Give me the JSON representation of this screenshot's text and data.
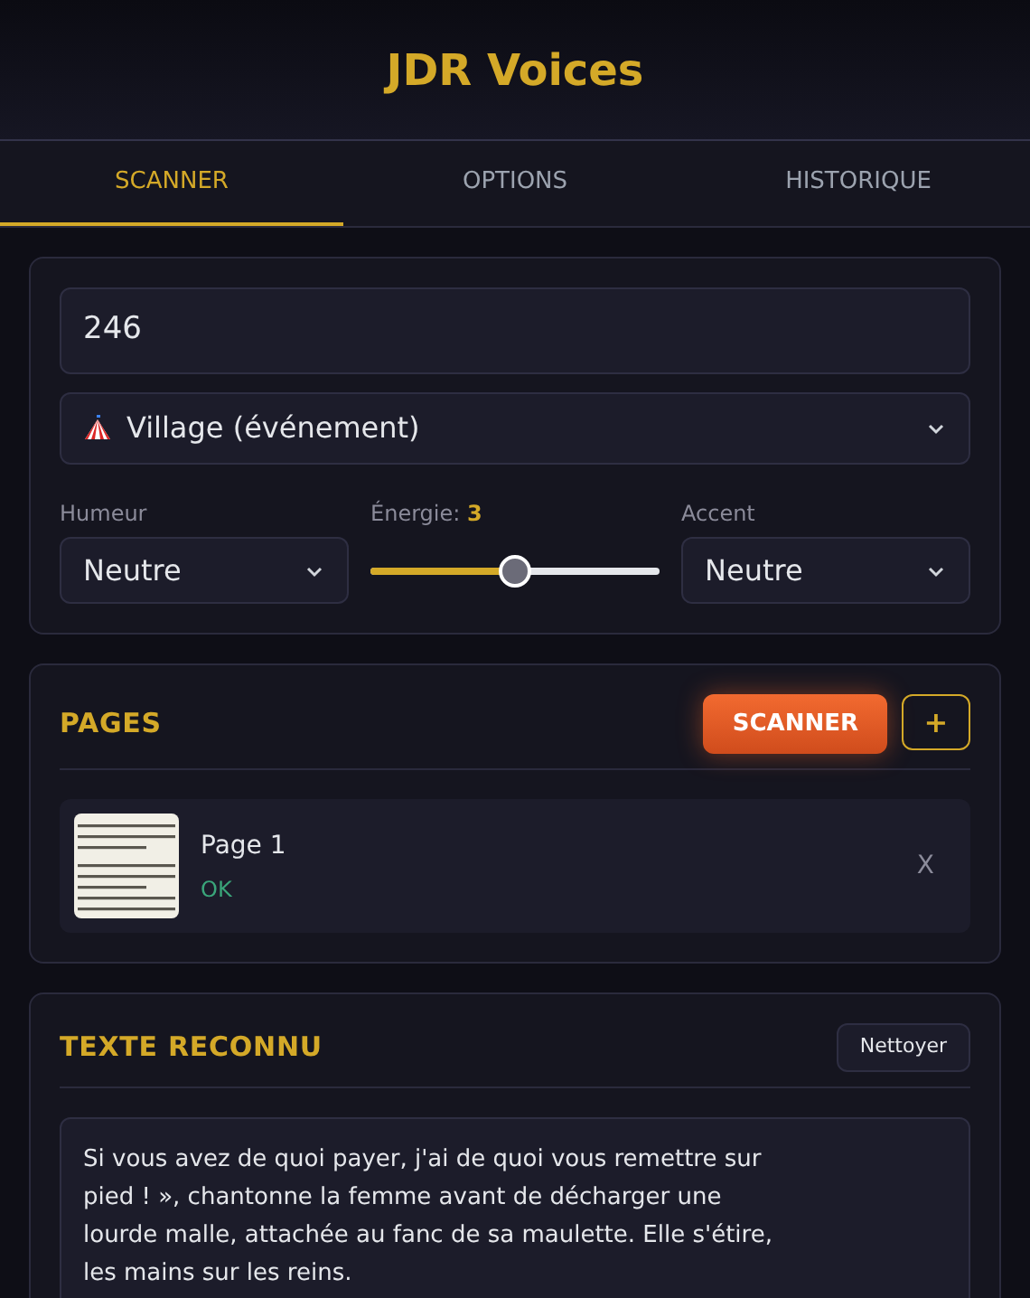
{
  "app_title": "JDR Voices",
  "tabs": [
    {
      "label": "SCANNER",
      "selected": true
    },
    {
      "label": "OPTIONS",
      "selected": false
    },
    {
      "label": "HISTORIQUE",
      "selected": false
    }
  ],
  "settings": {
    "number_field": {
      "value": "246"
    },
    "scene_select": {
      "value": "Village (événement)"
    },
    "mood": {
      "label": "Humeur",
      "value": "Neutre"
    },
    "energy": {
      "label": "Énergie:",
      "reading": "3",
      "level": 0.5
    },
    "accent": {
      "label": "Accent",
      "value": "Neutre"
    }
  },
  "pages": {
    "title": "PAGES",
    "scan_button": "SCANNER",
    "add_button": "+",
    "items": [
      {
        "kind": "picture",
        "name": "Page 1",
        "status": "OK",
        "remove": "X"
      }
    ]
  },
  "recognized_text": {
    "title": "TEXTE RECONNU",
    "clean_button": "Nettoyer",
    "text": "Si vous avez de quoi payer, j'ai de quoi vous remettre sur pied ! », chantonne la femme avant de décharger une lourde malle, attachée au fanc de sa maulette. Elle s'étire, les mains sur les reins."
  }
}
